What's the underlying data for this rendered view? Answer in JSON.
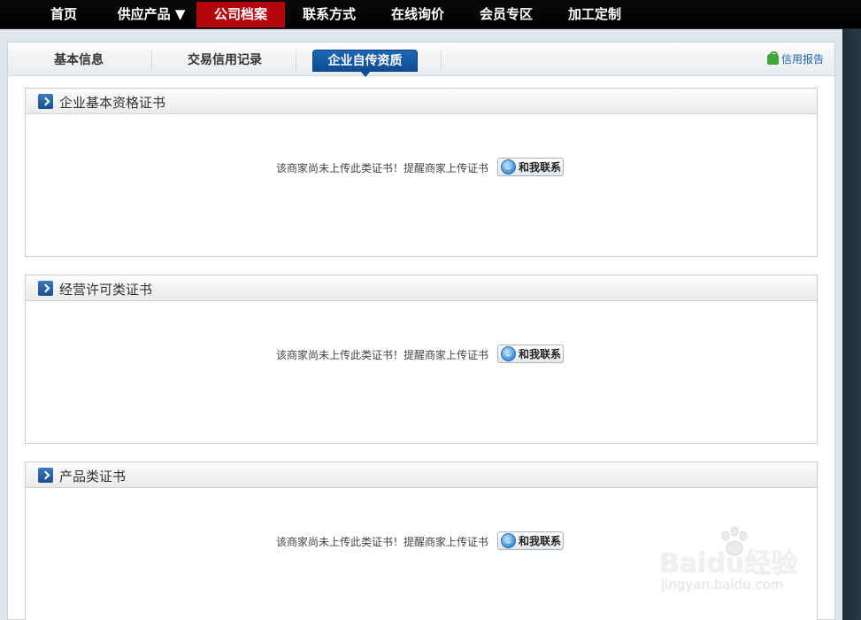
{
  "nav": {
    "items": [
      {
        "label": "首页",
        "active": false
      },
      {
        "label": "供应产品 ▼",
        "active": false
      },
      {
        "label": "公司档案",
        "active": true
      },
      {
        "label": "联系方式",
        "active": false
      },
      {
        "label": "在线询价",
        "active": false
      },
      {
        "label": "会员专区",
        "active": false
      },
      {
        "label": "加工定制",
        "active": false
      }
    ]
  },
  "tabs": {
    "items": [
      {
        "label": "基本信息",
        "active": false
      },
      {
        "label": "交易信用记录",
        "active": false
      },
      {
        "label": "企业自传资质",
        "active": true
      }
    ],
    "report_label": "信用报告"
  },
  "sections": [
    {
      "title": "企业基本资格证书",
      "notice": "该商家尚未上传此类证书！提醒商家上传证书",
      "button": "和我联系"
    },
    {
      "title": "经营许可类证书",
      "notice": "该商家尚未上传此类证书！提醒商家上传证书",
      "button": "和我联系"
    },
    {
      "title": "产品类证书",
      "notice": "该商家尚未上传此类证书！提醒商家上传证书",
      "button": "和我联系"
    }
  ],
  "watermark": {
    "logo": "Baidu经验",
    "url": "jingyan.baidu.com"
  },
  "colors": {
    "nav_active": "#b5060c",
    "tab_active": "#0d4c93",
    "link": "#1a62b0"
  }
}
